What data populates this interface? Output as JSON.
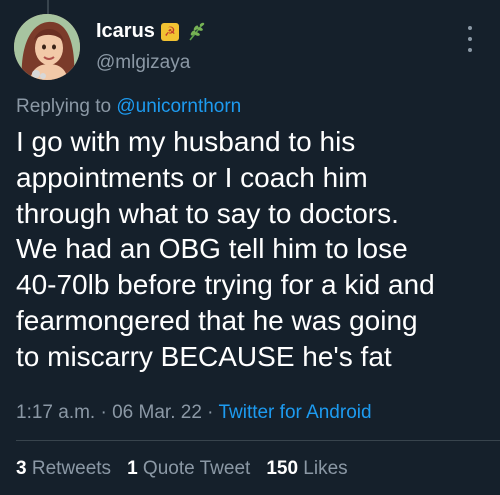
{
  "tweet": {
    "display_name": "Icarus",
    "handle": "@mlgizaya",
    "name_emojis": [
      "hammer-sickle-emoji",
      "herb-emoji"
    ],
    "reply_prefix": "Replying to ",
    "reply_mention": "@unicornthorn",
    "body": "I go with my husband to his\nappointments or I coach him\nthrough what to say to doctors.\nWe had an OBG  tell him to lose\n40-70lb before trying for a kid and\nfearmongered that he was going\nto miscarry BECAUSE he's fat",
    "time": "1:17 a.m.",
    "date": "06 Mar. 22",
    "separator": " · ",
    "source_app": "Twitter for Android"
  },
  "stats": {
    "retweets_count": "3",
    "retweets_label": "Retweets",
    "quote_count": "1",
    "quote_label": "Quote Tweet",
    "likes_count": "150",
    "likes_label": "Likes"
  },
  "colors": {
    "background": "#15202b",
    "text_primary": "#ffffff",
    "text_secondary": "#8b98a5",
    "accent": "#1d9bf0",
    "divider": "#38444d"
  }
}
